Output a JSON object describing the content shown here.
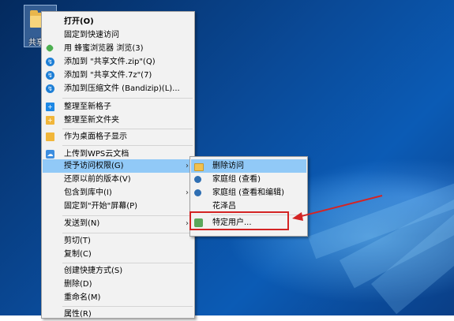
{
  "desktop": {
    "folder_label": "共享文"
  },
  "context_menu": {
    "items": [
      {
        "label": "打开(O)",
        "icon": "none",
        "bold": true
      },
      {
        "label": "固定到快速访问",
        "icon": "none"
      },
      {
        "label": "用 蜂蜜浏览器 浏览(3)",
        "icon": "honeyview-icon"
      },
      {
        "label": "添加到 \"共享文件.zip\"(Q)",
        "icon": "bandizip-icon"
      },
      {
        "label": "添加到 \"共享文件.7z\"(7)",
        "icon": "bandizip-icon"
      },
      {
        "label": "添加到压缩文件 (Bandizip)(L)...",
        "icon": "bandizip-icon"
      },
      {
        "label": "整理至新格子",
        "icon": "fences-icon"
      },
      {
        "label": "整理至新文件夹",
        "icon": "folder-icon"
      },
      {
        "label": "作为桌面格子显示",
        "icon": "folder-icon"
      },
      {
        "label": "上传到WPS云文档",
        "icon": "wps-cloud-icon"
      },
      {
        "label": "授予访问权限(G)",
        "arrow": "›"
      },
      {
        "label": "还原以前的版本(V)"
      },
      {
        "label": "包含到库中(I)",
        "arrow": "›"
      },
      {
        "label": "固定到\"开始\"屏幕(P)"
      },
      {
        "label": "发送到(N)",
        "arrow": "›"
      },
      {
        "label": "剪切(T)"
      },
      {
        "label": "复制(C)"
      },
      {
        "label": "创建快捷方式(S)"
      },
      {
        "label": "删除(D)"
      },
      {
        "label": "重命名(M)"
      },
      {
        "label": "属性(R)"
      }
    ]
  },
  "submenu": {
    "items": [
      {
        "label": "删除访问",
        "icon": "lock-icon"
      },
      {
        "label": "家庭组 (查看)",
        "icon": "homegroup-icon"
      },
      {
        "label": "家庭组 (查看和编辑)",
        "icon": "homegroup-icon"
      },
      {
        "label": "花泽吕",
        "icon": "none"
      },
      {
        "label": "特定用户...",
        "icon": "user-icon"
      }
    ]
  },
  "colors": {
    "highlight": "#91c9f7",
    "annotation_red": "#d42424",
    "menu_bg": "#f2f2f2"
  }
}
